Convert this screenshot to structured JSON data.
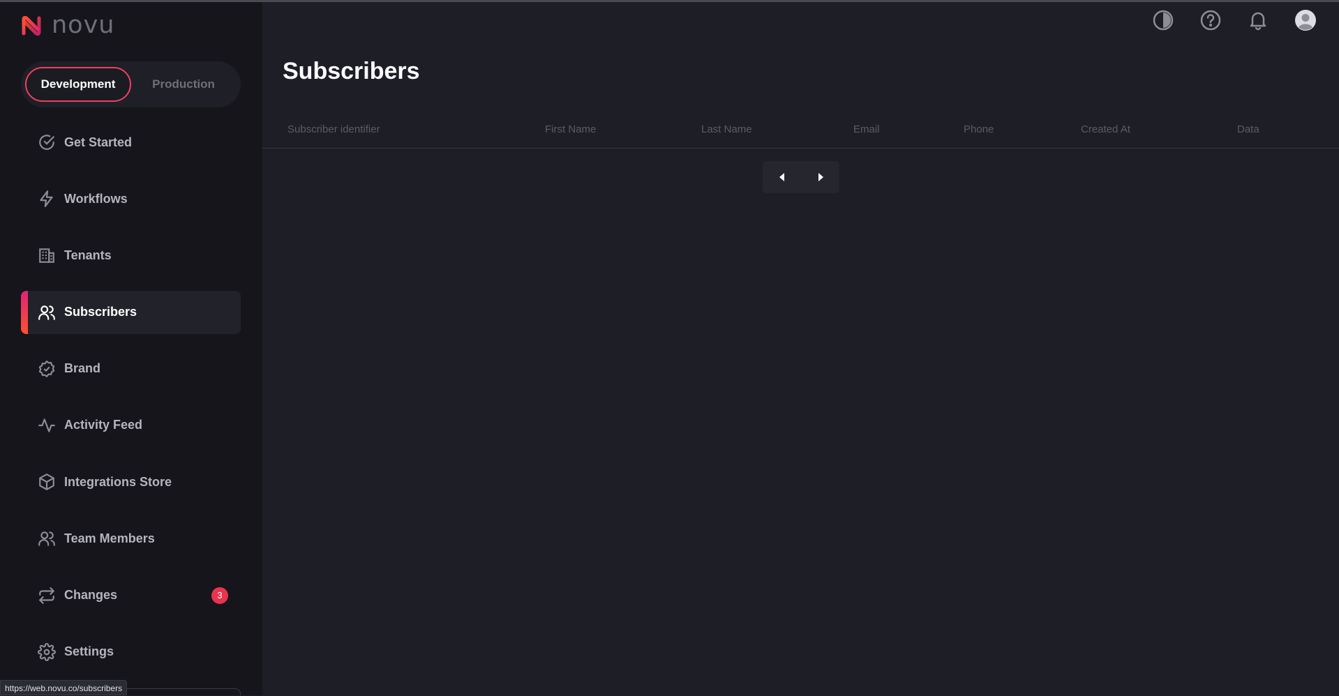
{
  "app": {
    "logo_text": "novu"
  },
  "environment": {
    "development": "Development",
    "production": "Production"
  },
  "nav": [
    {
      "label": "Get Started",
      "icon": "check-circle-icon"
    },
    {
      "label": "Workflows",
      "icon": "bolt-icon"
    },
    {
      "label": "Tenants",
      "icon": "building-icon"
    },
    {
      "label": "Subscribers",
      "icon": "users-icon"
    },
    {
      "label": "Brand",
      "icon": "badge-check-icon"
    },
    {
      "label": "Activity Feed",
      "icon": "activity-icon"
    },
    {
      "label": "Integrations Store",
      "icon": "box-icon"
    },
    {
      "label": "Team Members",
      "icon": "team-icon"
    },
    {
      "label": "Changes",
      "icon": "repeat-icon",
      "badge": "3"
    },
    {
      "label": "Settings",
      "icon": "gear-icon"
    }
  ],
  "header": {
    "icons": [
      "contrast-icon",
      "help-icon",
      "bell-icon",
      "avatar-icon"
    ]
  },
  "main": {
    "title": "Subscribers",
    "columns": [
      "Subscriber identifier",
      "First Name",
      "Last Name",
      "Email",
      "Phone",
      "Created At",
      "Data"
    ]
  },
  "status_bar": {
    "url": "https://web.novu.co/subscribers"
  },
  "colors": {
    "accent": "#f0405f",
    "sidebar_bg": "#15151b",
    "main_bg": "#1e1e26",
    "badge": "#e8344f"
  }
}
